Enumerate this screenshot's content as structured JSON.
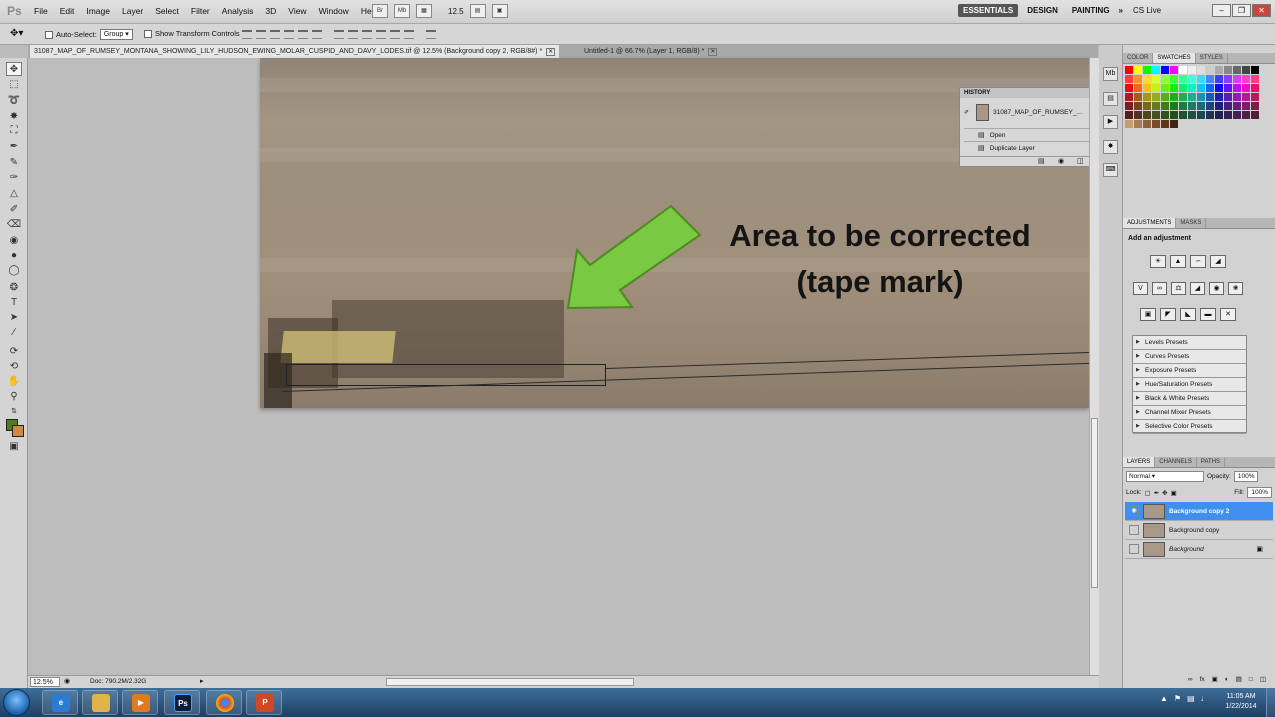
{
  "app": {
    "logo": "Ps"
  },
  "menu": [
    "File",
    "Edit",
    "Image",
    "Layer",
    "Select",
    "Filter",
    "Analysis",
    "3D",
    "View",
    "Window",
    "Help"
  ],
  "menu_tools": {
    "br": "Br",
    "mb": "Mb",
    "zoom": "12.5"
  },
  "workspaces": [
    "ESSENTIALS",
    "DESIGN",
    "PAINTING"
  ],
  "cslive": "CS Live",
  "options": {
    "auto_select": "Auto-Select:",
    "group": "Group",
    "show_transform": "Show Transform Controls"
  },
  "tabs": [
    {
      "label": "31087_MAP_OF_RUMSEY_MONTANA_SHOWING_LILY_HUDSON_EWING_MOLAR_CUSPID_AND_DAVY_LODES.tif @ 12.5% (Background copy 2, RGB/8#) *"
    },
    {
      "label": "Untitled-1 @ 66.7% (Layer 1, RGB/8) *"
    }
  ],
  "annotation": {
    "line1": "Area to be corrected",
    "line2": "(tape mark)",
    "arrow_color": "#7ac943"
  },
  "history": {
    "title": "HISTORY",
    "snapshot": "31087_MAP_OF_RUMSEY_...",
    "states": [
      "Open",
      "Duplicate Layer"
    ]
  },
  "status": {
    "zoom": "12.5%",
    "doc": "Doc: 790.2M/2.32G"
  },
  "color_panel": {
    "tabs": [
      "COLOR",
      "SWATCHES",
      "STYLES"
    ],
    "active": "SWATCHES"
  },
  "adjustments": {
    "tabs": [
      "ADJUSTMENTS",
      "MASKS"
    ],
    "label": "Add an adjustment",
    "presets": [
      "Levels Presets",
      "Curves Presets",
      "Exposure Presets",
      "Hue/Saturation Presets",
      "Black & White Presets",
      "Channel Mixer Presets",
      "Selective Color Presets"
    ]
  },
  "layers_panel": {
    "tabs": [
      "LAYERS",
      "CHANNELS",
      "PATHS"
    ],
    "blend": "Normal",
    "opacity_label": "Opacity:",
    "opacity": "100%",
    "lock_label": "Lock:",
    "fill_label": "Fill:",
    "fill": "100%",
    "layers": [
      "Background copy 2",
      "Background copy",
      "Background"
    ]
  },
  "colors": {
    "foreground": "#4f7d19",
    "background": "#d08a44",
    "selected_layer": "#3f8ff0"
  },
  "taskbar": {
    "time": "11:05 AM",
    "date": "1/22/2014",
    "ps_label": "Ps"
  }
}
